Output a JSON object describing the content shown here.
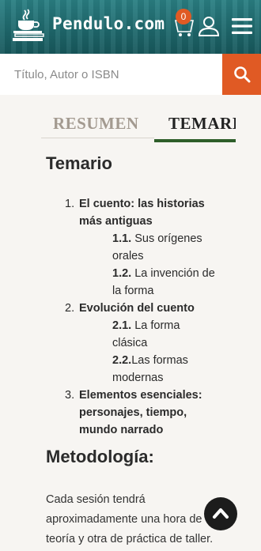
{
  "header": {
    "brand": "Pendulo.com",
    "cart_count": "0"
  },
  "search": {
    "placeholder": "Título, Autor o ISBN"
  },
  "tabs": [
    {
      "label": "RESUMEN",
      "active": false
    },
    {
      "label": "TEMARIO",
      "active": true
    }
  ],
  "syllabus": {
    "heading": "Temario",
    "items": [
      {
        "num": "1.",
        "title_lines": [
          "El cuento: las historias",
          "más antiguas"
        ],
        "subitems": [
          {
            "num": "1.1.",
            "lines": [
              " Sus orígenes",
              "orales"
            ]
          },
          {
            "num": "1.2.",
            "lines": [
              " La invención de",
              "la forma"
            ]
          }
        ]
      },
      {
        "num": "2.",
        "title_lines": [
          "Evolución del cuento"
        ],
        "subitems": [
          {
            "num": "2.1.",
            "lines": [
              " La forma",
              "clásica"
            ]
          },
          {
            "num": "2.2.",
            "lines": [
              "Las formas",
              "modernas"
            ]
          }
        ]
      },
      {
        "num": "3.",
        "title_lines": [
          "Elementos esenciales:",
          "personajes, tiempo,",
          "mundo narrado"
        ],
        "subitems": []
      }
    ]
  },
  "methodology": {
    "heading": "Metodología:",
    "paragraph_lines": [
      "Cada sesión tendrá",
      "aproximadamente una hora de",
      "teoría y otra de práctica de taller."
    ]
  },
  "colors": {
    "header_teal": "#1f6e72",
    "accent_orange": "#e05a24",
    "active_tab_green": "#2e5e2a"
  },
  "icons": {
    "logo": "coffee-books-icon",
    "cart": "cart-icon",
    "user": "user-icon",
    "menu": "menu-icon",
    "search": "search-icon",
    "scroll_top": "chevron-up-icon"
  }
}
